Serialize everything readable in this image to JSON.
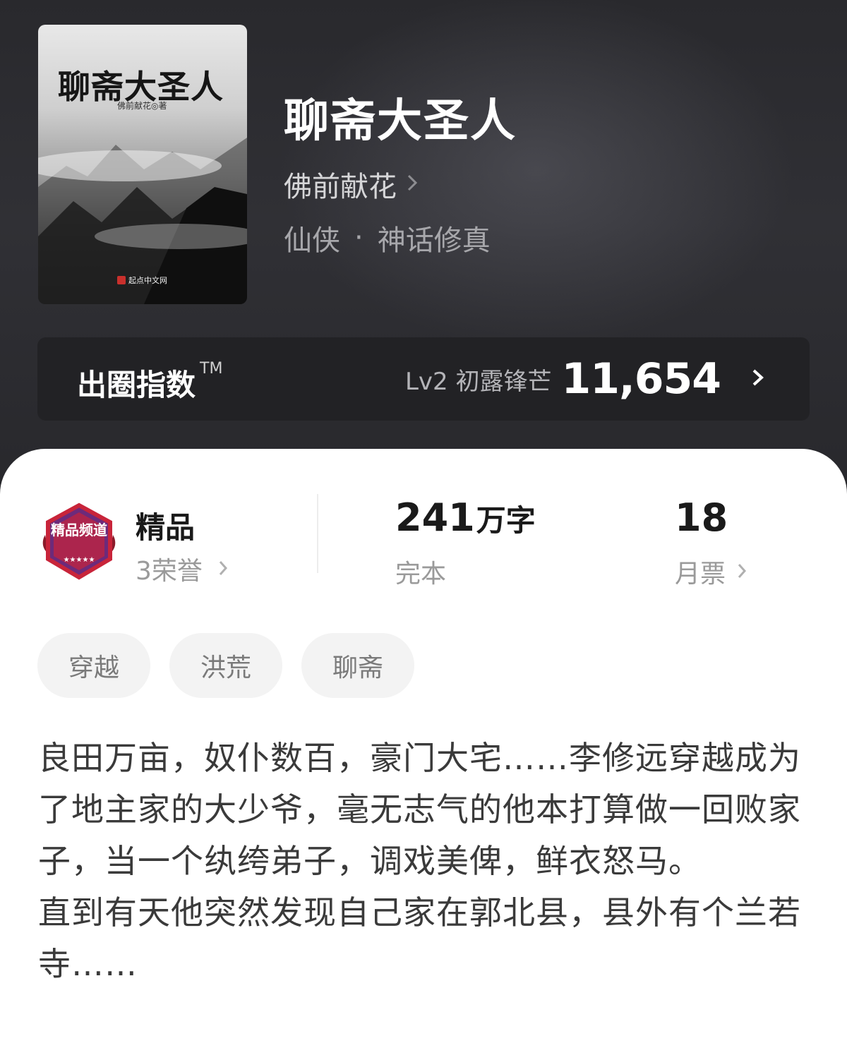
{
  "book": {
    "cover": {
      "title": "聊斋大圣人",
      "author": "佛前献花◎著",
      "publisher": "起点中文网"
    },
    "title": "聊斋大圣人",
    "author": "佛前献花",
    "genre": "仙侠",
    "genre_separator": "·",
    "subgenre": "神话修真"
  },
  "index_bar": {
    "label": "出圈指数",
    "trademark": "TM",
    "level": "Lv2 初露锋芒",
    "score": "11,654"
  },
  "stats": {
    "badge_text": "精品频道",
    "channel": "精品",
    "honors": "3荣誉",
    "word_count": "241",
    "word_unit": "万字",
    "status": "完本",
    "monthly_votes": "18",
    "monthly_votes_label": "月票"
  },
  "tags": [
    "穿越",
    "洪荒",
    "聊斋"
  ],
  "synopsis": "良田万亩，奴仆数百，豪门大宅……李修远穿越成为了地主家的大少爷，毫无志气的他本打算做一回败家子，当一个纨绔弟子，调戏美俾，鲜衣怒马。\n直到有天他突然发现自己家在郭北县，县外有个兰若寺……",
  "colors": {
    "header_bg": "#2c2c30",
    "index_bar_bg": "#222225",
    "badge_red": "#c8243a",
    "badge_purple": "#6d2a7a"
  }
}
